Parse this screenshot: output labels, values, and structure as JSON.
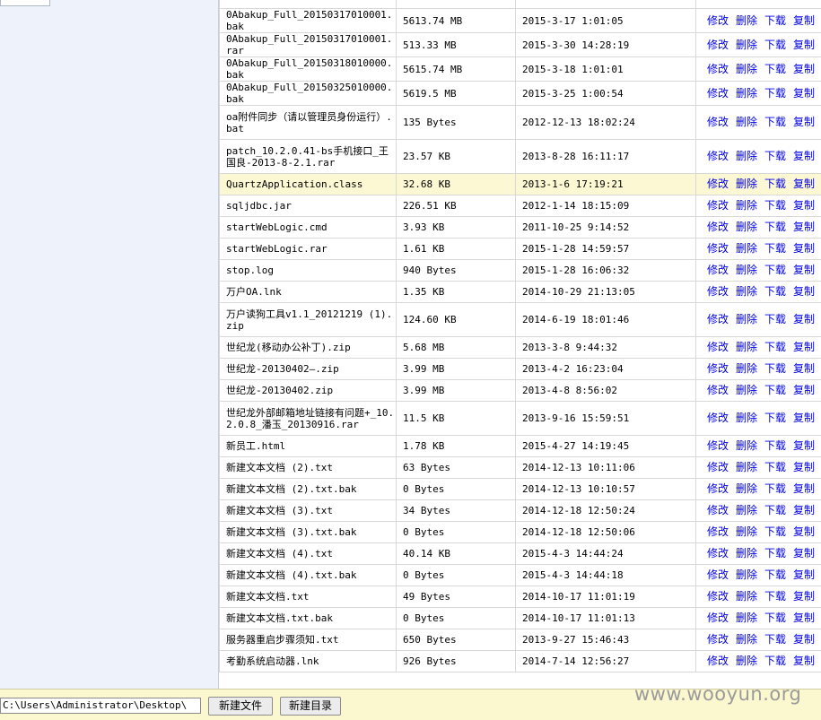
{
  "columns_shown": [
    "name",
    "size",
    "modified",
    "actions"
  ],
  "actions": {
    "edit": "修改",
    "delete": "删除",
    "download": "下载",
    "copy": "复制"
  },
  "rows": [
    {
      "name": "0Abakup_Full_20150317010001.bak",
      "size": "5613.74 MB",
      "date": "2015-3-17 1:01:05"
    },
    {
      "name": "0Abakup_Full_20150317010001.rar",
      "size": "513.33 MB",
      "date": "2015-3-30 14:28:19"
    },
    {
      "name": "0Abakup_Full_20150318010000.bak",
      "size": "5615.74 MB",
      "date": "2015-3-18 1:01:01"
    },
    {
      "name": "0Abakup_Full_20150325010000.bak",
      "size": "5619.5 MB",
      "date": "2015-3-25 1:00:54"
    },
    {
      "name": "oa附件同步（请以管理员身份运行）.bat",
      "size": "135 Bytes",
      "date": "2012-12-13 18:02:24"
    },
    {
      "name": "patch_10.2.0.41-bs手机接口_王国良-2013-8-2.1.rar",
      "size": "23.57 KB",
      "date": "2013-8-28 16:11:17"
    },
    {
      "name": "QuartzApplication.class",
      "size": "32.68 KB",
      "date": "2013-1-6 17:19:21",
      "highlight": true
    },
    {
      "name": "sqljdbc.jar",
      "size": "226.51 KB",
      "date": "2012-1-14 18:15:09"
    },
    {
      "name": "startWebLogic.cmd",
      "size": "3.93 KB",
      "date": "2011-10-25 9:14:52"
    },
    {
      "name": "startWebLogic.rar",
      "size": "1.61 KB",
      "date": "2015-1-28 14:59:57"
    },
    {
      "name": "stop.log",
      "size": "940 Bytes",
      "date": "2015-1-28 16:06:32"
    },
    {
      "name": "万户OA.lnk",
      "size": "1.35 KB",
      "date": "2014-10-29 21:13:05"
    },
    {
      "name": "万户读狗工具v1.1_20121219 (1).zip",
      "size": "124.60 KB",
      "date": "2014-6-19 18:01:46"
    },
    {
      "name": "世纪龙(移动办公补丁).zip",
      "size": "5.68 MB",
      "date": "2013-3-8 9:44:32"
    },
    {
      "name": "世纪龙-20130402—.zip",
      "size": "3.99 MB",
      "date": "2013-4-2 16:23:04"
    },
    {
      "name": "世纪龙-20130402.zip",
      "size": "3.99 MB",
      "date": "2013-4-8 8:56:02"
    },
    {
      "name": "世纪龙外部邮箱地址链接有问题+_10.2.0.8_潘玉_20130916.rar",
      "size": "11.5 KB",
      "date": "2013-9-16 15:59:51"
    },
    {
      "name": "新员工.html",
      "size": "1.78 KB",
      "date": "2015-4-27 14:19:45"
    },
    {
      "name": "新建文本文档 (2).txt",
      "size": "63 Bytes",
      "date": "2014-12-13 10:11:06"
    },
    {
      "name": "新建文本文档 (2).txt.bak",
      "size": "0 Bytes",
      "date": "2014-12-13 10:10:57"
    },
    {
      "name": "新建文本文档 (3).txt",
      "size": "34 Bytes",
      "date": "2014-12-18 12:50:24"
    },
    {
      "name": "新建文本文档 (3).txt.bak",
      "size": "0 Bytes",
      "date": "2014-12-18 12:50:06"
    },
    {
      "name": "新建文本文档 (4).txt",
      "size": "40.14 KB",
      "date": "2015-4-3 14:44:24"
    },
    {
      "name": "新建文本文档 (4).txt.bak",
      "size": "0 Bytes",
      "date": "2015-4-3 14:44:18"
    },
    {
      "name": "新建文本文档.txt",
      "size": "49 Bytes",
      "date": "2014-10-17 11:01:19"
    },
    {
      "name": "新建文本文档.txt.bak",
      "size": "0 Bytes",
      "date": "2014-10-17 11:01:13"
    },
    {
      "name": "服务器重启步骤须知.txt",
      "size": "650 Bytes",
      "date": "2013-9-27 15:46:43"
    },
    {
      "name": "考勤系统启动器.lnk",
      "size": "926 Bytes",
      "date": "2014-7-14 12:56:27"
    }
  ],
  "bottom": {
    "path_value": "C:\\Users\\Administrator\\Desktop\\",
    "new_file_label": "新建文件",
    "new_dir_label": "新建目录"
  },
  "watermark": "www.wooyun.org"
}
